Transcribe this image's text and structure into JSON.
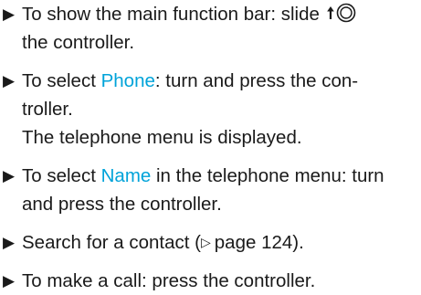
{
  "steps": [
    {
      "bullet_icon": "triangle-right-bullet-icon",
      "text_1": "To show the main function bar: slide",
      "icon": "controller-slide-up-icon",
      "text_2": "the controller."
    },
    {
      "bullet_icon": "triangle-right-bullet-icon",
      "text_pre": "To select ",
      "highlight": "Phone",
      "text_post": ": turn and press the con-",
      "text_line2": "troller.",
      "note": "The telephone menu is displayed."
    },
    {
      "bullet_icon": "triangle-right-bullet-icon",
      "text_pre": "To select ",
      "highlight": "Name",
      "text_post": " in the telephone menu: turn",
      "text_line2": "and press the controller."
    },
    {
      "bullet_icon": "triangle-right-bullet-icon",
      "text_pre": "Search for a contact (",
      "ref_icon": "page-reference-triangle-icon",
      "ref_text": "page 124",
      "text_post": ")."
    },
    {
      "bullet_icon": "triangle-right-bullet-icon",
      "text": "To make a call: press the controller."
    }
  ],
  "colors": {
    "text": "#1a1a1a",
    "highlight": "#00a3d9"
  }
}
